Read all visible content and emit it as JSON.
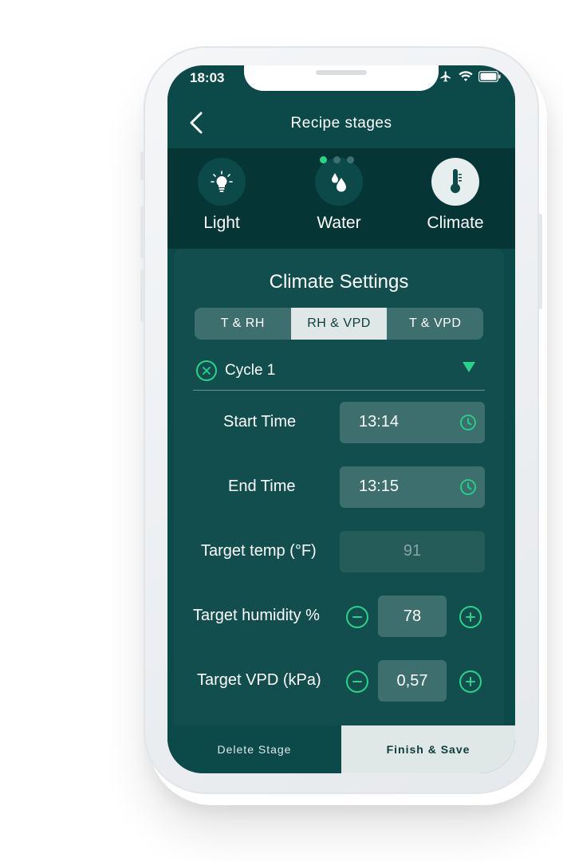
{
  "status": {
    "time": "18:03"
  },
  "header": {
    "title": "Recipe stages"
  },
  "stages": [
    {
      "label": "Light",
      "icon": "lightbulb-icon"
    },
    {
      "label": "Water",
      "icon": "water-drops-icon"
    },
    {
      "label": "Climate",
      "icon": "thermometer-icon"
    }
  ],
  "climate": {
    "title": "Climate Settings",
    "modes": [
      "T & RH",
      "RH & VPD",
      "T & VPD"
    ],
    "selected_mode": "RH & VPD",
    "cycle": {
      "name": "Cycle 1"
    },
    "start_time": {
      "label": "Start Time",
      "value": "13:14"
    },
    "end_time": {
      "label": "End Time",
      "value": "13:15"
    },
    "target_temp": {
      "label": "Target temp (°F)",
      "value": "91"
    },
    "target_humidity": {
      "label": "Target humidity %",
      "value": "78"
    },
    "target_vpd": {
      "label": "Target VPD (kPa)",
      "value": "0,57"
    }
  },
  "footer": {
    "delete_label": "Delete Stage",
    "finish_label": "Finish & Save"
  },
  "colors": {
    "accent": "#29d489",
    "background": "#0c4a4a",
    "card": "#114e4d",
    "light": "#dfe8e7"
  }
}
